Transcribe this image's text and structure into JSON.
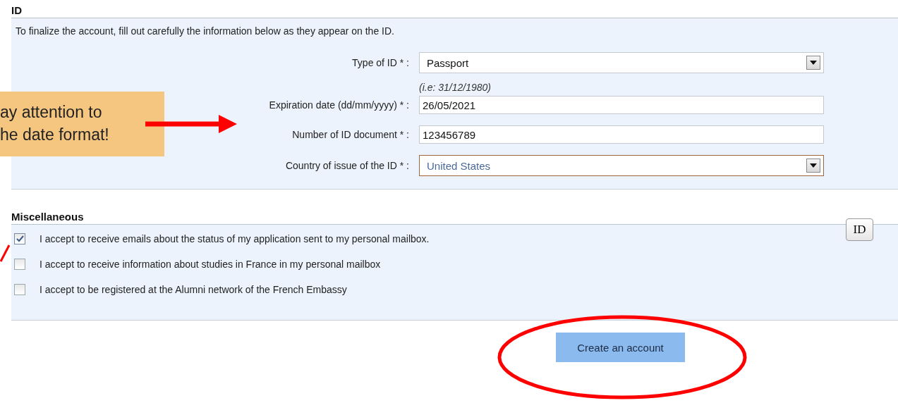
{
  "id_section": {
    "heading": "ID",
    "intro": "To finalize the account, fill out carefully the information below as they appear on the ID.",
    "fields": [
      {
        "kind": "select",
        "label": "Type of ID * :",
        "value": "Passport",
        "focused": false
      },
      {
        "kind": "text",
        "label": "Expiration date (dd/mm/yyyy) * :",
        "hint": "(i.e: 31/12/1980)",
        "value": "26/05/2021",
        "focused": false
      },
      {
        "kind": "text",
        "label": "Number of ID document * :",
        "value": "123456789",
        "focused": false
      },
      {
        "kind": "select",
        "label": "Country of issue of the ID * :",
        "value": "United States",
        "focused": true
      }
    ]
  },
  "misc_section": {
    "heading": "Miscellaneous",
    "tag": "ID",
    "options": [
      {
        "label": "I accept to receive emails about the status of my application sent to my personal mailbox.",
        "checked": true
      },
      {
        "label": "I accept to receive information about studies in France in my personal mailbox",
        "checked": false
      },
      {
        "label": "I accept to be registered at the Alumni network of the French Embassy",
        "checked": false
      }
    ]
  },
  "submit": "Create an account",
  "callout": {
    "lines": [
      "ay attention to",
      "he date format!"
    ]
  }
}
